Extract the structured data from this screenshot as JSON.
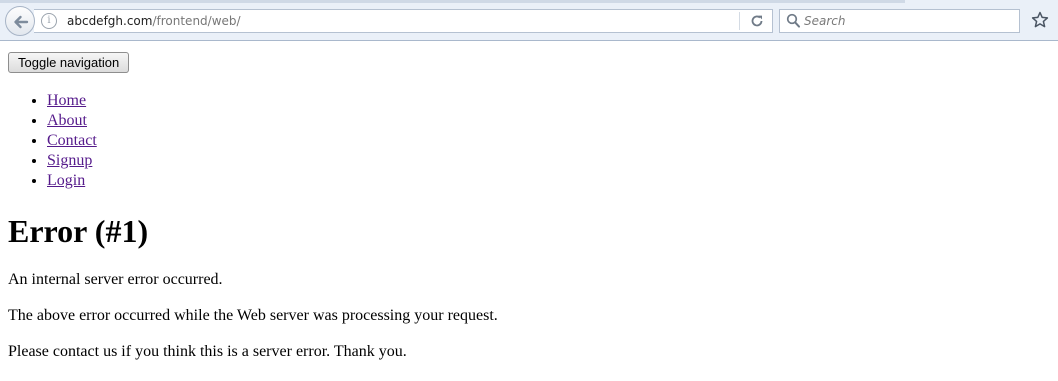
{
  "browser": {
    "address": {
      "domain": "abcdefgh.com",
      "path": "/frontend/web/"
    },
    "search": {
      "placeholder": "Search"
    },
    "icons": {
      "back": "back-arrow-icon",
      "info": "info-icon",
      "reload": "reload-icon",
      "search": "search-icon",
      "bookmark": "star-icon"
    }
  },
  "page": {
    "toggle_label": "Toggle navigation",
    "nav": [
      {
        "label": "Home"
      },
      {
        "label": "About"
      },
      {
        "label": "Contact"
      },
      {
        "label": "Signup"
      },
      {
        "label": "Login"
      }
    ],
    "error_title": "Error (#1)",
    "messages": [
      "An internal server error occurred.",
      "The above error occurred while the Web server was processing your request.",
      "Please contact us if you think this is a server error. Thank you."
    ],
    "link_color": "#551a8b"
  }
}
